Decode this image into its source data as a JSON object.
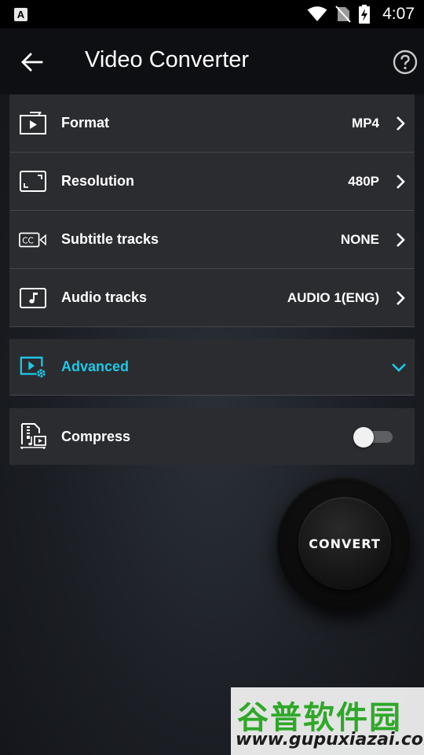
{
  "status_bar": {
    "notification_glyph": "A",
    "time": "4:07"
  },
  "app_bar": {
    "title": "Video Converter"
  },
  "settings": [
    {
      "label": "Format",
      "value": "MP4"
    },
    {
      "label": "Resolution",
      "value": "480P"
    },
    {
      "label": "Subtitle tracks",
      "value": "NONE"
    },
    {
      "label": "Audio tracks",
      "value": "AUDIO 1(ENG)"
    }
  ],
  "advanced": {
    "label": "Advanced",
    "expanded": false
  },
  "compress": {
    "label": "Compress",
    "enabled": false
  },
  "convert_button": {
    "label": "CONVERT"
  },
  "watermark": {
    "chinese": "谷普软件园",
    "url": "www.gupuxiazai.com"
  },
  "colors": {
    "accent": "#1ec8e8",
    "card_bg": "#2b2c30",
    "app_bar_bg": "#0e0f12",
    "watermark_green": "#2fa829"
  }
}
